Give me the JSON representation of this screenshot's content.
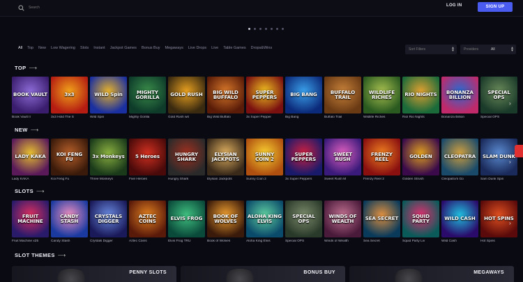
{
  "header": {
    "search_placeholder": "Search",
    "login_label": "LOG IN",
    "signup_label": "SIGN UP"
  },
  "filters": {
    "categories": [
      "All",
      "Top",
      "New",
      "Low Wagering",
      "Slots",
      "Instant",
      "Jackpot Games",
      "Bonus Buy",
      "Megaways",
      "Live Drops",
      "Live",
      "Table Games",
      "Drops&Wins"
    ],
    "active_index": 0,
    "sort_placeholder": "Sort Filters",
    "provider_placeholder": "Providers",
    "provider_value": "All"
  },
  "sections": {
    "top_title": "TOP",
    "new_title": "NEW",
    "slots_title": "SLOTS",
    "themes_title": "SLOT THEMES"
  },
  "top_games": [
    {
      "name": "Book Vault II",
      "logo": "BOOK VAULT",
      "c1": "#3b1d6e",
      "c2": "#8c6cd6"
    },
    {
      "name": "3x3 Hold The S",
      "logo": "3x3",
      "c1": "#b51d12",
      "c2": "#f0a21a"
    },
    {
      "name": "Wild Spin",
      "logo": "WILD Spin",
      "c1": "#1a2fa0",
      "c2": "#e6b22a"
    },
    {
      "name": "Mighty Gorilla",
      "logo": "MIGHTY GORILLA",
      "c1": "#0e3b2a",
      "c2": "#3a8c4a"
    },
    {
      "name": "Gold Rush wit",
      "logo": "GOLD RUSH",
      "c1": "#3a2a10",
      "c2": "#e8a020"
    },
    {
      "name": "Big Wild Buffalo",
      "logo": "BIG WILD BUFFALO",
      "c1": "#5a1c08",
      "c2": "#d8782a"
    },
    {
      "name": "3x Super Pepper",
      "logo": "SUPER PEPPERS",
      "c1": "#7a1010",
      "c2": "#f0c020"
    },
    {
      "name": "Big Bang",
      "logo": "BIG BANG",
      "c1": "#0c2a7a",
      "c2": "#3aa0ea"
    },
    {
      "name": "Buffalo Trail",
      "logo": "BUFFALO TRAIL",
      "c1": "#6a3a14",
      "c2": "#c8823a"
    },
    {
      "name": "Wildlife Riches",
      "logo": "WILDLIFE RICHES",
      "c1": "#2a5a20",
      "c2": "#a8c050"
    },
    {
      "name": "Riol Rio Nights",
      "logo": "RIO NIGHTS",
      "c1": "#1a6a3a",
      "c2": "#e0a030"
    },
    {
      "name": "Bonanza Billion",
      "logo": "BONANZA BILLION",
      "c1": "#c02a6a",
      "c2": "#2a6ad0"
    },
    {
      "name": "Special OPS",
      "logo": "SPECIAL OPS",
      "c1": "#1a3a2a",
      "c2": "#6a8a5a"
    }
  ],
  "new_games": [
    {
      "name": "Lady KAKA",
      "logo": "LADY KAKA",
      "c1": "#5a1a5a",
      "c2": "#e8c030"
    },
    {
      "name": "Koi Feng Fu",
      "logo": "KOI FENG FU",
      "c1": "#3a1a0a",
      "c2": "#b8602a"
    },
    {
      "name": "Three Monkeys",
      "logo": "3x Monkeys",
      "c1": "#1a3a1a",
      "c2": "#8ab040"
    },
    {
      "name": "Five Heroes",
      "logo": "5 Heroes",
      "c1": "#4a0a0a",
      "c2": "#d03020"
    },
    {
      "name": "Hungry Shark",
      "logo": "HUNGRY SHARK",
      "c1": "#2a2a2a",
      "c2": "#a03020"
    },
    {
      "name": "Elysian Jackpots",
      "logo": "ELYSIAN JACKPOTS",
      "c1": "#3a2a1a",
      "c2": "#e0b060"
    },
    {
      "name": "Sunny Coin 2",
      "logo": "SUNNY COIN 2",
      "c1": "#b05010",
      "c2": "#f8d030"
    },
    {
      "name": "3x Super Peppers",
      "logo": "SUPER PEPPERS",
      "c1": "#1a1a6a",
      "c2": "#d02040"
    },
    {
      "name": "Sweet Rush M",
      "logo": "SWEET RUSH",
      "c1": "#3a1a7a",
      "c2": "#e060c0"
    },
    {
      "name": "Frenzy Reel 2",
      "logo": "FRENZY REEL",
      "c1": "#8a1010",
      "c2": "#f08020"
    },
    {
      "name": "Golden Strush",
      "logo": "GOLDEN",
      "c1": "#3a0a4a",
      "c2": "#e0a020"
    },
    {
      "name": "Cleopatra's Go",
      "logo": "CLEOPATRA",
      "c1": "#1a4a6a",
      "c2": "#d0a040"
    },
    {
      "name": "Sam Dunk Spin",
      "logo": "SLAM DUNK",
      "c1": "#1a2a5a",
      "c2": "#5a8ad0"
    }
  ],
  "slot_games": [
    {
      "name": "Fruit Machine x25",
      "logo": "FRUIT MACHINE",
      "c1": "#2a1a6a",
      "c2": "#e03060"
    },
    {
      "name": "Candy Stash",
      "logo": "CANDY STASH",
      "c1": "#1a3aa0",
      "c2": "#f090c0"
    },
    {
      "name": "Crystals Digger",
      "logo": "CRYSTALS DIGGER",
      "c1": "#1a1a5a",
      "c2": "#6a8ae0"
    },
    {
      "name": "Aztec Coins",
      "logo": "AZTEC COINS",
      "c1": "#5a1a0a",
      "c2": "#e08020"
    },
    {
      "name": "Elvis Frog TRU",
      "logo": "ELVIS FROG",
      "c1": "#0a4a3a",
      "c2": "#40c080"
    },
    {
      "name": "Book of Wolves",
      "logo": "BOOK OF WOLVES",
      "c1": "#3a1a0a",
      "c2": "#f0a030"
    },
    {
      "name": "Aloha King Elvis",
      "logo": "ALOHA KING ELVIS",
      "c1": "#0a4a6a",
      "c2": "#60d0a0"
    },
    {
      "name": "Special OPS",
      "logo": "SPECIAL OPS",
      "c1": "#2a3a2a",
      "c2": "#7a8a6a"
    },
    {
      "name": "Winds of Wealth",
      "logo": "WINDS OF WEALTH",
      "c1": "#4a1a3a",
      "c2": "#c07090"
    },
    {
      "name": "Sea Secret",
      "logo": "SEA SECRET",
      "c1": "#0a3a5a",
      "c2": "#e09040"
    },
    {
      "name": "Squid Party Liv",
      "logo": "SQUID PARTY",
      "c1": "#0a5a5a",
      "c2": "#e03070"
    },
    {
      "name": "Wild Cash",
      "logo": "WILD CASH",
      "c1": "#2a0a6a",
      "c2": "#20c0e0"
    },
    {
      "name": "Hot Spins",
      "logo": "HOT SPINS",
      "c1": "#5a0a0a",
      "c2": "#e05020"
    }
  ],
  "themes": [
    "PENNY SLOTS",
    "BONUS BUY",
    "MEGAWAYS"
  ],
  "colors": {
    "background": "#0a0a12",
    "accent": "#4a5cf0",
    "badge": "#e03030"
  }
}
